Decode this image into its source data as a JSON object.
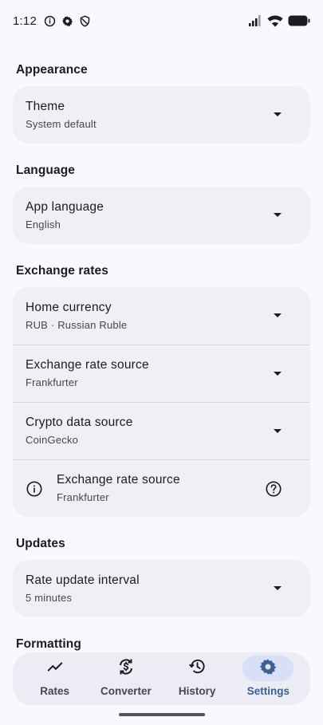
{
  "status_bar": {
    "time": "1:12",
    "left_icons": [
      "info-circle-icon",
      "gear-icon",
      "shield-icon"
    ],
    "right_icons": [
      "signal-icon",
      "wifi-icon",
      "battery-icon"
    ]
  },
  "sections": {
    "appearance": {
      "title": "Appearance",
      "theme": {
        "label": "Theme",
        "value": "System default"
      }
    },
    "language": {
      "title": "Language",
      "app_language": {
        "label": "App language",
        "value": "English"
      }
    },
    "exchange_rates": {
      "title": "Exchange rates",
      "home_currency": {
        "label": "Home currency",
        "value": "RUB · Russian Ruble"
      },
      "exchange_rate_source": {
        "label": "Exchange rate source",
        "value": "Frankfurter"
      },
      "crypto_data_source": {
        "label": "Crypto data source",
        "value": "CoinGecko"
      },
      "info_row": {
        "label": "Exchange rate source",
        "value": "Frankfurter"
      }
    },
    "updates": {
      "title": "Updates",
      "rate_update_interval": {
        "label": "Rate update interval",
        "value": "5 minutes"
      }
    },
    "formatting": {
      "title": "Formatting"
    }
  },
  "bottom_nav": {
    "items": [
      {
        "label": "Rates",
        "icon": "trending-up-icon",
        "active": false
      },
      {
        "label": "Converter",
        "icon": "currency-exchange-icon",
        "active": false
      },
      {
        "label": "History",
        "icon": "history-icon",
        "active": false
      },
      {
        "label": "Settings",
        "icon": "gear-icon",
        "active": true
      }
    ]
  },
  "colors": {
    "background": "#F9F8FD",
    "card": "#F0EFF6",
    "accent": "#3F5F90",
    "active_pill": "#D9DFF6"
  }
}
